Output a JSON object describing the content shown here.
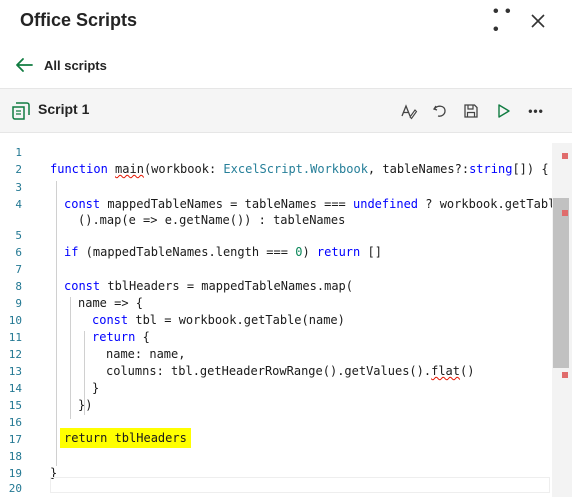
{
  "header": {
    "title": "Office Scripts",
    "more_icon": "more-horizontal-icon",
    "close_icon": "close-icon"
  },
  "nav": {
    "back_label": "All scripts",
    "back_icon": "arrow-left-icon",
    "accent_color": "#107c41"
  },
  "script": {
    "name": "Script 1",
    "icon": "script-icon",
    "toolbar": [
      "edit-text-icon",
      "undo-icon",
      "save-icon",
      "run-icon",
      "more-horizontal-icon"
    ]
  },
  "editor": {
    "line_numbers": [
      "1",
      "2",
      "3",
      "4",
      "",
      "5",
      "6",
      "7",
      "8",
      "9",
      "10",
      "11",
      "12",
      "13",
      "14",
      "15",
      "16",
      "17",
      "18",
      "19",
      "20"
    ],
    "code": {
      "l2_kw": "function",
      "l2_fn": "main",
      "l2_a": "(workbook: ",
      "l2_type": "ExcelScript.Workbook",
      "l2_b": ", tableNames?:",
      "l2_str": "string",
      "l2_c": "[]) {",
      "l4_kw": "const",
      "l4_a": " mappedTableNames = tableNames === ",
      "l4_undef": "undefined",
      "l4_b": " ? workbook.getTables",
      "l4w": "().map(e => e.getName()) : tableNames",
      "l6_kw": "if",
      "l6_a": " (mappedTableNames.length === ",
      "l6_num": "0",
      "l6_b": ") ",
      "l6_ret": "return",
      "l6_c": " []",
      "l8_kw": "const",
      "l8_a": " tblHeaders = mappedTableNames.map(",
      "l9": "name => {",
      "l10_kw": "const",
      "l10_a": " tbl = workbook.getTable(name)",
      "l11_kw": "return",
      "l11_a": " {",
      "l12": "name: name,",
      "l13_a": "columns: tbl.getHeaderRowRange().getValues().",
      "l13_flat": "flat",
      "l13_b": "()",
      "l14": "}",
      "l15": "})",
      "l17": "return tblHeaders",
      "l19": "}"
    }
  }
}
